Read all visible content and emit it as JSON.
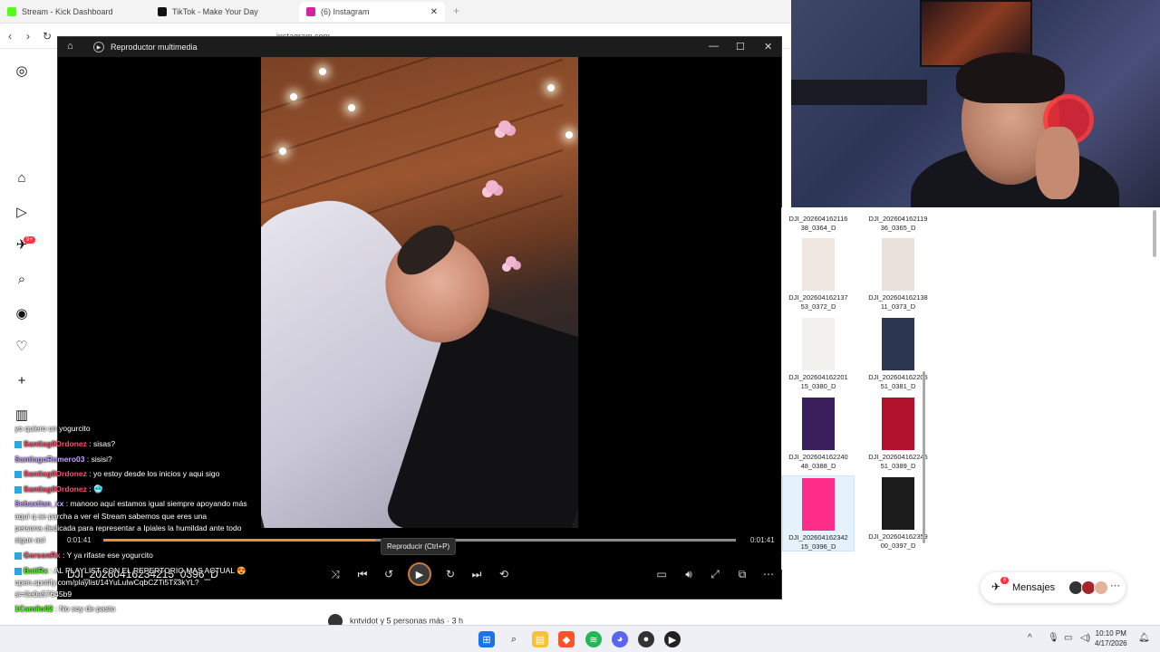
{
  "browser": {
    "tabs": [
      {
        "title": "Stream - Kick Dashboard",
        "color": "#53fc18"
      },
      {
        "title": "TikTok - Make Your Day",
        "color": "#111111"
      },
      {
        "title": "(6) Instagram",
        "color": "#d6249f"
      }
    ],
    "url": "instagram.com"
  },
  "player": {
    "title": "Reproductor multimedia",
    "filename": "DJI_20260416234215_0396_D",
    "current_time": "0:01:41",
    "end_time": "0:01:41",
    "progress_pct": 43,
    "tooltip": "Reproducir (Ctrl+P)"
  },
  "chat": [
    {
      "user": "",
      "text": "yo quiero un yogurcito",
      "ucolor": "#ffffff"
    },
    {
      "user": "Santiag0Ordonez",
      "text": "sisas?",
      "ucolor": "#ff4d6d"
    },
    {
      "user": "SantiagoRomero03",
      "text": "sisisi?",
      "ucolor": "#c9a0ff"
    },
    {
      "user": "Santiag0Ordonez",
      "text": "yo estoy desde los inicios y aqui sigo",
      "ucolor": "#ff4d6d"
    },
    {
      "user": "Santiag0Ordonez",
      "text": "🥶",
      "ucolor": "#ff4d6d"
    },
    {
      "user": "Sebaxtian_xx",
      "text": "manooo aquí estamos igual siempre apoyando más",
      "ucolor": "#c9a0ff"
    },
    {
      "user": "",
      "text": "aquí q se parcha a ver el Stream sabemos que eres una",
      "ucolor": "#ffffff"
    },
    {
      "user": "",
      "text": "persona dedicada para representar a Ipiales la humildad ante todo",
      "ucolor": "#ffffff"
    },
    {
      "user": "",
      "text": "sigue así",
      "ucolor": "#ffffff"
    },
    {
      "user": "GersonRx",
      "text": "Y ya rifaste ese yogurcito",
      "ucolor": "#ff4d6d"
    },
    {
      "user": "BatiRx",
      "text": "AL PLAYLIST CON EL REPERTORIO MAS ACTUAL 😍",
      "ucolor": "#53fc18"
    },
    {
      "user": "",
      "text": "open.spotify.com/playlist/14YuLuIwCqbCZTi5Tx3kYL?",
      "ucolor": "#ffffff"
    },
    {
      "user": "",
      "text": "si=0e0a57645b9",
      "ucolor": "#ffffff"
    },
    {
      "user": "1Camilo02",
      "text": "No soy de pasto",
      "ucolor": "#53fc18"
    }
  ],
  "explorer": {
    "files": [
      {
        "name": "DJI_202604162116 38_0364_D",
        "thumb": "#e9e3dc"
      },
      {
        "name": "DJI_202604162119 36_0365_D",
        "thumb": "#e9e3dc"
      },
      {
        "name": "DJI_202604162137 53_0372_D",
        "thumb": "#efe7df"
      },
      {
        "name": "DJI_202604162138 11_0373_D",
        "thumb": "#e8e2da"
      },
      {
        "name": "DJI_202604162201 15_0380_D",
        "thumb": "#f3f1ee"
      },
      {
        "name": "DJI_202604162205 51_0381_D",
        "thumb": "#2c3650"
      },
      {
        "name": "DJI_202604162240 48_0388_D",
        "thumb": "#3a1f5c"
      },
      {
        "name": "DJI_202604162245 51_0389_D",
        "thumb": "#b3122e"
      },
      {
        "name": "DJI_202604162342 15_0396_D",
        "thumb": "#ff2d8a"
      },
      {
        "name": "DJI_202604162359 00_0397_D",
        "thumb": "#1b1b1b"
      }
    ]
  },
  "mensajes": {
    "label": "Mensajes",
    "badge": "6"
  },
  "ig": {
    "notif_badge": "9+",
    "footer": "kntvidot y 5 personas más · 3 h"
  },
  "clock": {
    "time": "10:10 PM",
    "date": "4/17/2026"
  }
}
